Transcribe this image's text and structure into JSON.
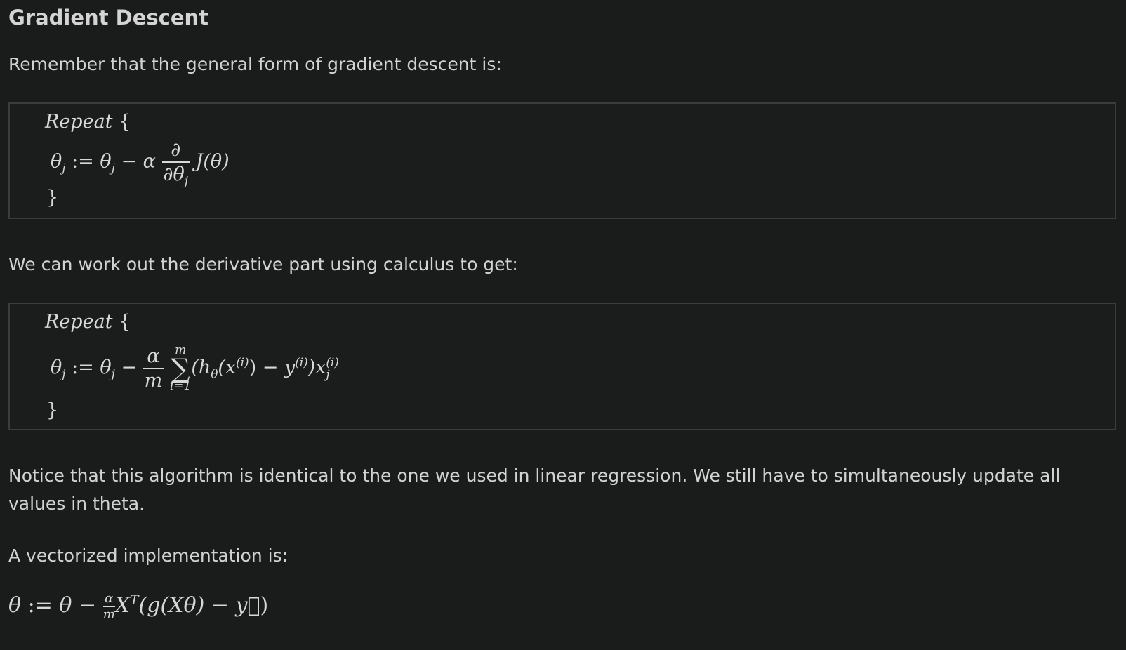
{
  "heading": "Gradient Descent",
  "intro_text": "Remember that the general form of gradient descent is:",
  "box1": {
    "repeat": "Repeat",
    "open_brace": "{",
    "close_brace": "}",
    "lhs": "θ",
    "lhs_sub": "j",
    "assign": ":=",
    "rhs_theta": "θ",
    "rhs_sub": "j",
    "minus": "−",
    "alpha": "α",
    "partial_num": "∂",
    "partial_den": "∂θ",
    "partial_den_sub": "j",
    "cost": "J(θ)"
  },
  "derivative_text": "We can work out the derivative part using calculus to get:",
  "box2": {
    "repeat": "Repeat",
    "open_brace": "{",
    "close_brace": "}",
    "lhs": "θ",
    "lhs_sub": "j",
    "assign": ":=",
    "rhs_theta": "θ",
    "rhs_sub": "j",
    "minus": "−",
    "frac_num": "α",
    "frac_den": "m",
    "sum_upper": "m",
    "sum_symbol": "∑",
    "sum_lower": "i=1",
    "h": "(h",
    "h_sub": "θ",
    "x_open": "(x",
    "x_sup": "(i)",
    "x_close": ")",
    "minus2": "−",
    "y": "y",
    "y_sup": "(i)",
    "paren_close": ")x",
    "xj_sup": "(i)",
    "xj_sub": "j"
  },
  "notice_text": "Notice that this algorithm is identical to the one we used in linear regression. We still have to simultaneously update all values in theta.",
  "vector_text": "A vectorized implementation is:",
  "vector_formula": {
    "theta": "θ",
    "assign": ":=",
    "theta2": "θ",
    "minus": "−",
    "frac_num": "α",
    "frac_den": "m",
    "X": "X",
    "T": "T",
    "body": "(g(Xθ) − ",
    "y_vec": "y⃗",
    "close": ")"
  }
}
